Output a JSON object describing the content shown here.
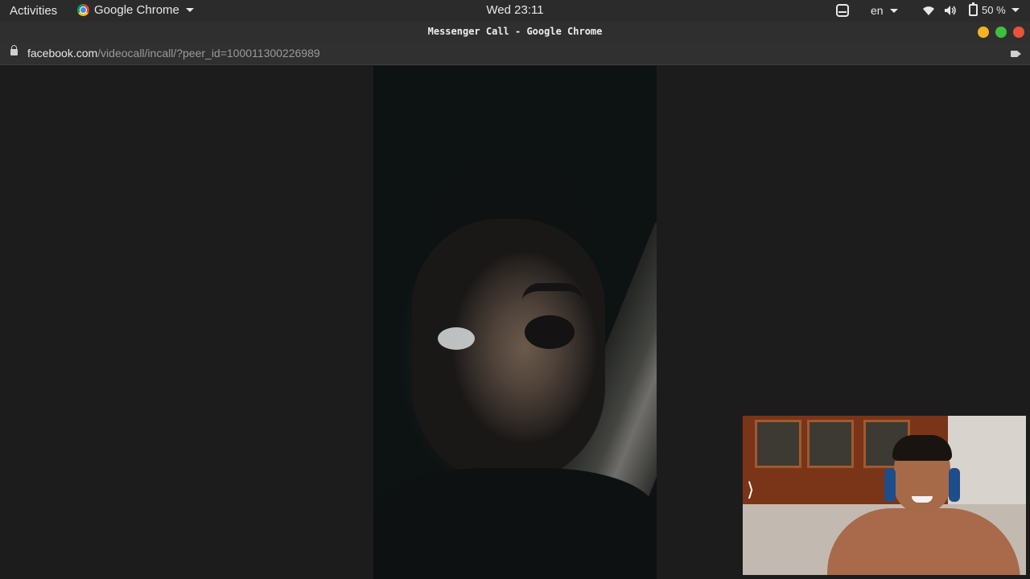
{
  "topbar": {
    "activities": "Activities",
    "app_name": "Google Chrome",
    "clock": "Wed 23:11",
    "language": "en",
    "battery": "50 %"
  },
  "window": {
    "title": "Messenger Call - Google Chrome"
  },
  "urlbar": {
    "host": "facebook.com",
    "path": "/videocall/incall/?peer_id=100011300226989"
  },
  "call": {
    "selfview_toggle": "⟩"
  },
  "colors": {
    "minimize": "#f4b225",
    "maximize": "#3fbe40",
    "close": "#e9533a"
  }
}
